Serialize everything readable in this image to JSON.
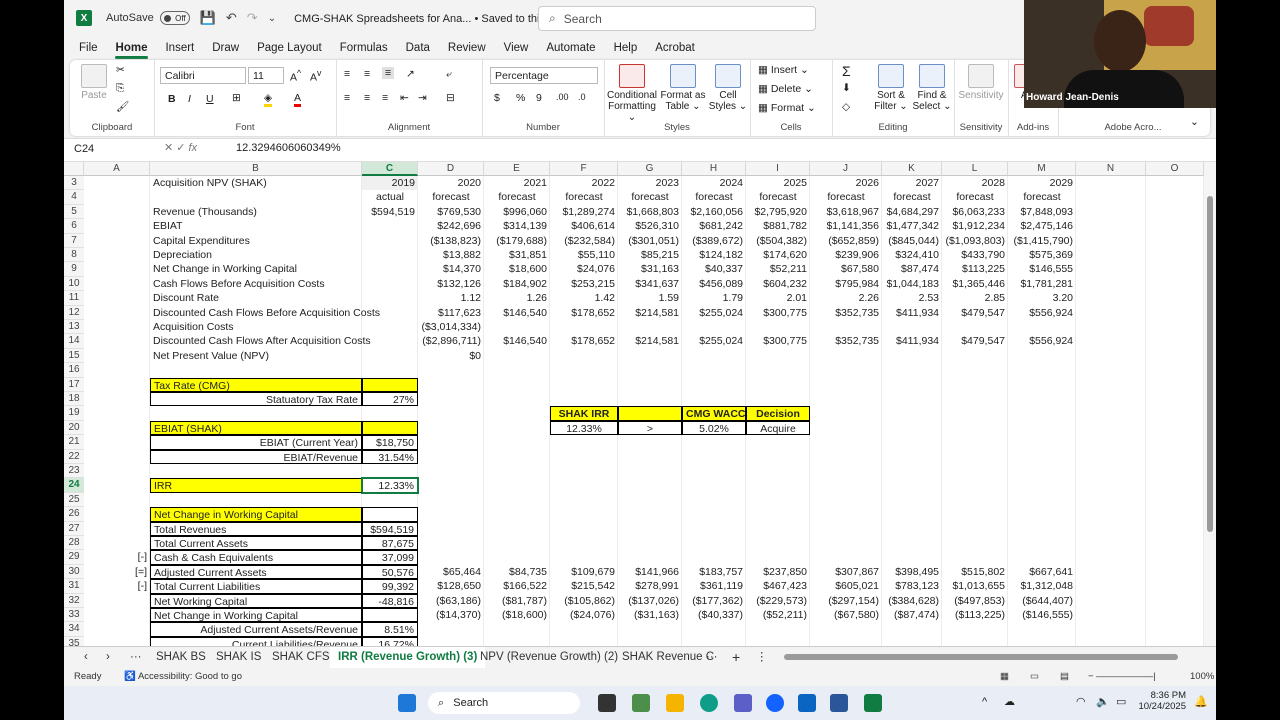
{
  "titlebar": {
    "autosave_label": "AutoSave",
    "autosave_state": "Off",
    "doc_title": "CMG-SHAK Spreadsheets for Ana... • Saved to this PC ⌄",
    "search_placeholder": "Search"
  },
  "ribbon_tabs": [
    "File",
    "Home",
    "Insert",
    "Draw",
    "Page Layout",
    "Formulas",
    "Data",
    "Review",
    "View",
    "Automate",
    "Help",
    "Acrobat"
  ],
  "ribbon": {
    "clipboard": {
      "paste": "Paste",
      "label": "Clipboard"
    },
    "font": {
      "name": "Calibri",
      "size": "11",
      "label": "Font"
    },
    "alignment": {
      "label": "Alignment"
    },
    "number": {
      "format": "Percentage",
      "label": "Number"
    },
    "styles": {
      "conditional": "Conditional Formatting ⌄",
      "format_table": "Format as Table ⌄",
      "cell_styles": "Cell Styles ⌄",
      "label": "Styles"
    },
    "cells": {
      "insert": "Insert",
      "delete": "Delete",
      "format": "Format",
      "label": "Cells"
    },
    "editing": {
      "sort": "Sort & Filter ⌄",
      "find": "Find & Select ⌄",
      "label": "Editing"
    },
    "sensitivity": {
      "btn": "Sensitivity",
      "label": "Sensitivity"
    },
    "addins": {
      "btn": "Ad",
      "label": "Add-ins"
    },
    "adobe": {
      "label": "Adobe Acro..."
    }
  },
  "formula_bar": {
    "namebox": "C24",
    "formula": "12.3294606060349%"
  },
  "webcam": {
    "name": "Howard Jean-Denis"
  },
  "columns": [
    "A",
    "B",
    "C",
    "D",
    "E",
    "F",
    "G",
    "H",
    "I",
    "J",
    "K",
    "L",
    "M",
    "N",
    "O"
  ],
  "rows": [
    "3",
    "4",
    "5",
    "6",
    "7",
    "8",
    "9",
    "10",
    "11",
    "12",
    "13",
    "14",
    "15",
    "16",
    "17",
    "18",
    "19",
    "20",
    "21",
    "22",
    "23",
    "24",
    "25",
    "26",
    "27",
    "28",
    "29",
    "30",
    "31",
    "32",
    "33",
    "34",
    "35"
  ],
  "table": {
    "header_title": "Acquisition NPV (SHAK)",
    "years": [
      "2019",
      "2020",
      "2021",
      "2022",
      "2023",
      "2024",
      "2025",
      "2026",
      "2027",
      "2028",
      "2029"
    ],
    "year_types": [
      "actual",
      "forecast",
      "forecast",
      "forecast",
      "forecast",
      "forecast",
      "forecast",
      "forecast",
      "forecast",
      "forecast",
      "forecast"
    ],
    "lines": [
      {
        "label": "Revenue (Thousands)",
        "values": [
          "$594,519",
          "$769,530",
          "$996,060",
          "$1,289,274",
          "$1,668,803",
          "$2,160,056",
          "$2,795,920",
          "$3,618,967",
          "$4,684,297",
          "$6,063,233",
          "$7,848,093"
        ]
      },
      {
        "label": "EBIAT",
        "values": [
          "",
          "$242,696",
          "$314,139",
          "$406,614",
          "$526,310",
          "$681,242",
          "$881,782",
          "$1,141,356",
          "$1,477,342",
          "$1,912,234",
          "$2,475,146"
        ]
      },
      {
        "label": "Capital Expenditures",
        "values": [
          "",
          "($138,823)",
          "($179,688)",
          "($232,584)",
          "($301,051)",
          "($389,672)",
          "($504,382)",
          "($652,859)",
          "($845,044)",
          "($1,093,803)",
          "($1,415,790)"
        ]
      },
      {
        "label": "Depreciation",
        "values": [
          "",
          "$13,882",
          "$31,851",
          "$55,110",
          "$85,215",
          "$124,182",
          "$174,620",
          "$239,906",
          "$324,410",
          "$433,790",
          "$575,369"
        ]
      },
      {
        "label": "Net Change in Working Capital",
        "values": [
          "",
          "$14,370",
          "$18,600",
          "$24,076",
          "$31,163",
          "$40,337",
          "$52,211",
          "$67,580",
          "$87,474",
          "$113,225",
          "$146,555"
        ]
      },
      {
        "label": "Cash Flows Before Acquisition Costs",
        "values": [
          "",
          "$132,126",
          "$184,902",
          "$253,215",
          "$341,637",
          "$456,089",
          "$604,232",
          "$795,984",
          "$1,044,183",
          "$1,365,446",
          "$1,781,281"
        ]
      },
      {
        "label": "Discount Rate",
        "values": [
          "",
          "1.12",
          "1.26",
          "1.42",
          "1.59",
          "1.79",
          "2.01",
          "2.26",
          "2.53",
          "2.85",
          "3.20"
        ]
      },
      {
        "label": "Discounted Cash Flows Before Acquisition Costs",
        "values": [
          "",
          "$117,623",
          "$146,540",
          "$178,652",
          "$214,581",
          "$255,024",
          "$300,775",
          "$352,735",
          "$411,934",
          "$479,547",
          "$556,924"
        ]
      },
      {
        "label": "Acquisition Costs",
        "values": [
          "",
          "($3,014,334)",
          "",
          "",
          "",
          "",
          "",
          "",
          "",
          "",
          ""
        ]
      },
      {
        "label": "Discounted Cash Flows After Acquisition Costs",
        "values": [
          "",
          "($2,896,711)",
          "$146,540",
          "$178,652",
          "$214,581",
          "$255,024",
          "$300,775",
          "$352,735",
          "$411,934",
          "$479,547",
          "$556,924"
        ]
      },
      {
        "label": "Net Present Value (NPV)",
        "values": [
          "",
          "$0",
          "",
          "",
          "",
          "",
          "",
          "",
          "",
          "",
          ""
        ]
      }
    ]
  },
  "tax": {
    "title": "Tax Rate (CMG)",
    "label": "Statuatory Tax Rate",
    "value": "27%"
  },
  "ebiat": {
    "title": "EBIAT (SHAK)",
    "current_label": "EBIAT (Current Year)",
    "current_value": "$18,750",
    "ratio_label": "EBIAT/Revenue",
    "ratio_value": "31.54%"
  },
  "irr": {
    "label": "IRR",
    "value": "12.33%"
  },
  "decision": {
    "h1": "SHAK IRR",
    "h2": "CMG WACC",
    "h3": "Decision",
    "v1": "12.33%",
    "cmp": ">",
    "v2": "5.02%",
    "v3": "Acquire"
  },
  "wc": {
    "title": "Net Change in Working Capital",
    "rows": [
      {
        "prefix": "",
        "label": "Total Revenues",
        "c": "$594,519"
      },
      {
        "prefix": "",
        "label": "Total Current Assets",
        "c": "87,675"
      },
      {
        "prefix": "[-]",
        "label": "Cash & Cash Equivalents",
        "c": "37,099"
      },
      {
        "prefix": "[=]",
        "label": "Adjusted Current Assets",
        "c": "50,576"
      },
      {
        "prefix": "[-]",
        "label": "Total Current Liabilities",
        "c": "99,392"
      },
      {
        "prefix": "",
        "label": "Net Working Capital",
        "c": "-48,816"
      },
      {
        "prefix": "",
        "label": "Net Change in Working Capital",
        "c": ""
      },
      {
        "prefix": "",
        "label": "Adjusted Current Assets/Revenue",
        "c": "8.51%"
      },
      {
        "prefix": "",
        "label": "Current Liabilities/Revenue",
        "c": "16.72%"
      }
    ],
    "adj_ca": [
      "$65,464",
      "$84,735",
      "$109,679",
      "$141,966",
      "$183,757",
      "$237,850",
      "$307,867",
      "$398,495",
      "$515,802",
      "$667,641"
    ],
    "tcl": [
      "$128,650",
      "$166,522",
      "$215,542",
      "$278,991",
      "$361,119",
      "$467,423",
      "$605,021",
      "$783,123",
      "$1,013,655",
      "$1,312,048"
    ],
    "nwc": [
      "($63,186)",
      "($81,787)",
      "($105,862)",
      "($137,026)",
      "($177,362)",
      "($229,573)",
      "($297,154)",
      "($384,628)",
      "($497,853)",
      "($644,407)"
    ],
    "nchg": [
      "($14,370)",
      "($18,600)",
      "($24,076)",
      "($31,163)",
      "($40,337)",
      "($52,211)",
      "($67,580)",
      "($87,474)",
      "($113,225)",
      "($146,555)"
    ]
  },
  "sheet_tabs": [
    "SHAK BS",
    "SHAK IS",
    "SHAK CFS",
    "IRR (Revenue Growth) (3)",
    "NPV (Revenue Growth) (2)",
    "SHAK Revenue C"
  ],
  "status": {
    "ready": "Ready",
    "accessibility": "Accessibility: Good to go",
    "zoom": "100%"
  },
  "taskbar": {
    "search": "Search",
    "time": "8:36 PM",
    "date": "10/24/2025"
  }
}
